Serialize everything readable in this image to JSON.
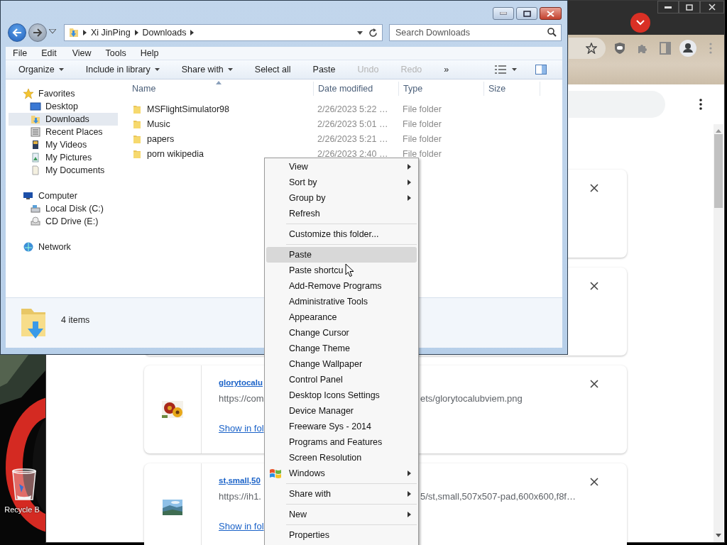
{
  "desktop": {
    "icons": [
      {
        "label": "Recycle B"
      }
    ]
  },
  "browser": {
    "downloads": [
      {
        "kind": "covered"
      },
      {
        "kind": "covered"
      },
      {
        "kind": "file",
        "name": "glorytocalu",
        "url_start": "https://com",
        "url_end": "ets/glorytocalubviem.png",
        "action": "Show in fol"
      },
      {
        "kind": "file",
        "name": "st,small,50",
        "url_start": "https://ih1.",
        "url_end": "5/st,small,507x507-pad,600x600,f8f…",
        "action": "Show in fol"
      }
    ]
  },
  "explorer": {
    "address": {
      "crumbs": [
        "Xi JinPing",
        "Downloads"
      ]
    },
    "search": {
      "placeholder": "Search Downloads"
    },
    "menu_bar": [
      "File",
      "Edit",
      "View",
      "Tools",
      "Help"
    ],
    "toolbar": [
      {
        "label": "Organize",
        "dropdown": true,
        "disabled": false
      },
      {
        "label": "Include in library",
        "dropdown": true,
        "disabled": false
      },
      {
        "label": "Share with",
        "dropdown": true,
        "disabled": false
      },
      {
        "label": "Select all",
        "dropdown": false,
        "disabled": false
      },
      {
        "label": "Paste",
        "dropdown": false,
        "disabled": false
      },
      {
        "label": "Undo",
        "dropdown": false,
        "disabled": true
      },
      {
        "label": "Redo",
        "dropdown": false,
        "disabled": true
      },
      {
        "label": "»",
        "dropdown": false,
        "disabled": false
      }
    ],
    "nav": [
      {
        "label": "Favorites",
        "kind": "favorites",
        "selected": false,
        "children": [
          {
            "label": "Desktop",
            "kind": "desktop",
            "selected": false
          },
          {
            "label": "Downloads",
            "kind": "downloads",
            "selected": true
          },
          {
            "label": "Recent Places",
            "kind": "recent",
            "selected": false
          },
          {
            "label": "My Videos",
            "kind": "videos",
            "selected": false
          },
          {
            "label": "My Pictures",
            "kind": "pictures",
            "selected": false
          },
          {
            "label": "My Documents",
            "kind": "documents",
            "selected": false
          }
        ]
      },
      {
        "label": "Computer",
        "kind": "computer",
        "selected": false,
        "children": [
          {
            "label": "Local Disk (C:)",
            "kind": "disk",
            "selected": false
          },
          {
            "label": "CD Drive (E:)",
            "kind": "cd",
            "selected": false
          }
        ]
      },
      {
        "label": "Network",
        "kind": "network",
        "selected": false
      }
    ],
    "columns": [
      {
        "label": "Name",
        "sorted": true
      },
      {
        "label": "Date modified",
        "sorted": false
      },
      {
        "label": "Type",
        "sorted": false
      },
      {
        "label": "Size",
        "sorted": false
      }
    ],
    "rows": [
      {
        "name": "MSFlightSimulator98",
        "date": "2/26/2023 5:22 …",
        "type": "File folder"
      },
      {
        "name": "Music",
        "date": "2/26/2023 5:01 …",
        "type": "File folder"
      },
      {
        "name": "papers",
        "date": "2/26/2023 5:21 …",
        "type": "File folder"
      },
      {
        "name": "porn wikipedia",
        "date": "2/26/2023 2:40 …",
        "type": "File folder"
      }
    ],
    "status": {
      "count": "4 items"
    }
  },
  "context_menu": {
    "items": [
      {
        "kind": "item",
        "label": "View",
        "submenu": true,
        "selected": false
      },
      {
        "kind": "item",
        "label": "Sort by",
        "submenu": true,
        "selected": false
      },
      {
        "kind": "item",
        "label": "Group by",
        "submenu": true,
        "selected": false
      },
      {
        "kind": "item",
        "label": "Refresh",
        "submenu": false,
        "selected": false
      },
      {
        "kind": "separator"
      },
      {
        "kind": "item",
        "label": "Customize this folder...",
        "submenu": false,
        "selected": false
      },
      {
        "kind": "separator"
      },
      {
        "kind": "item",
        "label": "Paste",
        "submenu": false,
        "selected": true
      },
      {
        "kind": "item",
        "label": "Paste shortcu",
        "submenu": false,
        "selected": false
      },
      {
        "kind": "item",
        "label": "Add-Remove Programs",
        "submenu": false,
        "selected": false
      },
      {
        "kind": "item",
        "label": "Administrative Tools",
        "submenu": false,
        "selected": false
      },
      {
        "kind": "item",
        "label": "Appearance",
        "submenu": false,
        "selected": false
      },
      {
        "kind": "item",
        "label": "Change Cursor",
        "submenu": false,
        "selected": false
      },
      {
        "kind": "item",
        "label": "Change Theme",
        "submenu": false,
        "selected": false
      },
      {
        "kind": "item",
        "label": "Change Wallpaper",
        "submenu": false,
        "selected": false
      },
      {
        "kind": "item",
        "label": "Control Panel",
        "submenu": false,
        "selected": false
      },
      {
        "kind": "item",
        "label": "Desktop Icons Settings",
        "submenu": false,
        "selected": false
      },
      {
        "kind": "item",
        "label": "Device Manager",
        "submenu": false,
        "selected": false
      },
      {
        "kind": "item",
        "label": "Freeware Sys - 2014",
        "submenu": false,
        "selected": false
      },
      {
        "kind": "item",
        "label": "Programs and Features",
        "submenu": false,
        "selected": false
      },
      {
        "kind": "item",
        "label": "Screen Resolution",
        "submenu": false,
        "selected": false
      },
      {
        "kind": "item",
        "label": "Windows",
        "submenu": true,
        "selected": false,
        "logo": true
      },
      {
        "kind": "separator"
      },
      {
        "kind": "item",
        "label": "Share with",
        "submenu": true,
        "selected": false
      },
      {
        "kind": "separator"
      },
      {
        "kind": "item",
        "label": "New",
        "submenu": true,
        "selected": false
      },
      {
        "kind": "separator"
      },
      {
        "kind": "item",
        "label": "Properties",
        "submenu": false,
        "selected": false
      }
    ]
  }
}
